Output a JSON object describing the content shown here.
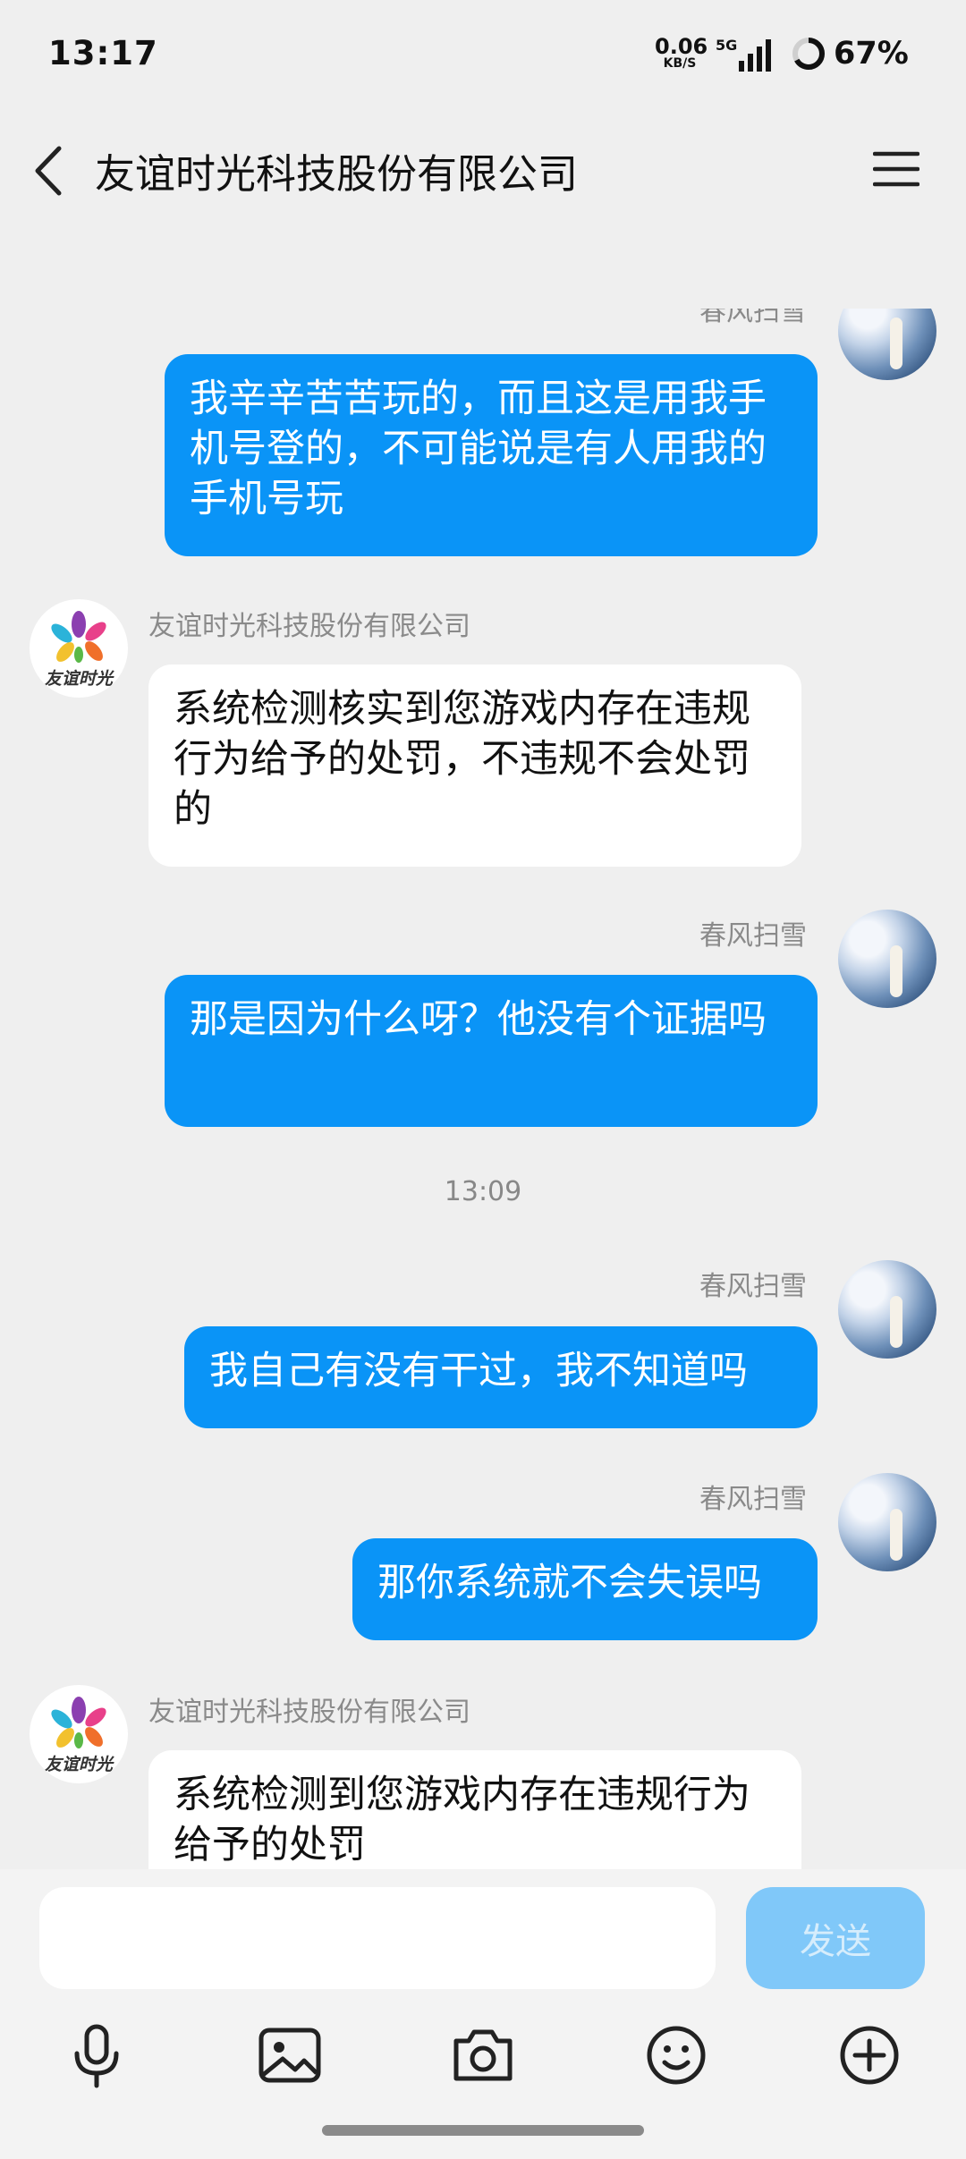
{
  "status_bar": {
    "time": "13:17",
    "net_speed": "0.06",
    "net_speed_unit": "KB/S",
    "network": "5G",
    "battery": "67%",
    "battery_level": 0.67
  },
  "header": {
    "title": "友谊时光科技股份有限公司"
  },
  "messages": [
    {
      "sender": "春风扫雪",
      "direction": "out",
      "text": "我辛辛苦苦玩的，而且这是用我手机号登的，不可能说是有人用我的手机号玩"
    },
    {
      "sender": "友谊时光科技股份有限公司",
      "direction": "in",
      "text": "系统检测核实到您游戏内存在违规行为给予的处罚，不违规不会处罚的"
    },
    {
      "sender": "春风扫雪",
      "direction": "out",
      "text": "那是因为什么呀？他没有个证据吗"
    },
    {
      "sender": "春风扫雪",
      "direction": "out",
      "text": "我自己有没有干过，我不知道吗"
    },
    {
      "sender": "春风扫雪",
      "direction": "out",
      "text": "那你系统就不会失误吗"
    },
    {
      "sender": "友谊时光科技股份有限公司",
      "direction": "in",
      "text": "系统检测到您游戏内存在违规行为给予的处罚"
    }
  ],
  "timestamp": "13:09",
  "company_logo_text": "友谊时光",
  "input": {
    "placeholder": "",
    "value": "",
    "send_label": "发送"
  },
  "toolbar": [
    "microphone-icon",
    "image-icon",
    "camera-icon",
    "emoji-icon",
    "plus-icon"
  ],
  "colors": {
    "outgoing_bubble": "#0a94f7",
    "incoming_bubble": "#ffffff",
    "send_button": "#80c8f9",
    "background": "#efefef"
  }
}
